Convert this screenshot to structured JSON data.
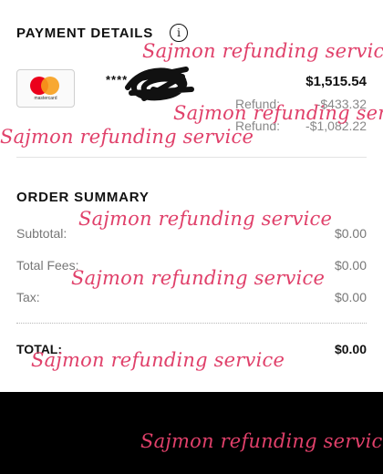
{
  "payment": {
    "title": "PAYMENT DETAILS",
    "info_icon": "info-icon",
    "card_brand": "mastercard",
    "card_masked": "****",
    "amount": "$1,515.54",
    "refunds": [
      {
        "label": "Refund:",
        "value": "-$433.32"
      },
      {
        "label": "Refund:",
        "value": "-$1,082.22"
      }
    ]
  },
  "order": {
    "title": "ORDER SUMMARY",
    "rows": [
      {
        "label": "Subtotal:",
        "value": "$0.00"
      },
      {
        "label": "Total Fees:",
        "value": "$0.00"
      },
      {
        "label": "Tax:",
        "value": "$0.00"
      }
    ],
    "total_label": "TOTAL:",
    "total_value": "$0.00"
  },
  "watermark": "Sajmon refunding service",
  "colors": {
    "watermark": "#e0406a",
    "mastercard_red": "#eb001b",
    "mastercard_orange": "#f79e1b"
  }
}
